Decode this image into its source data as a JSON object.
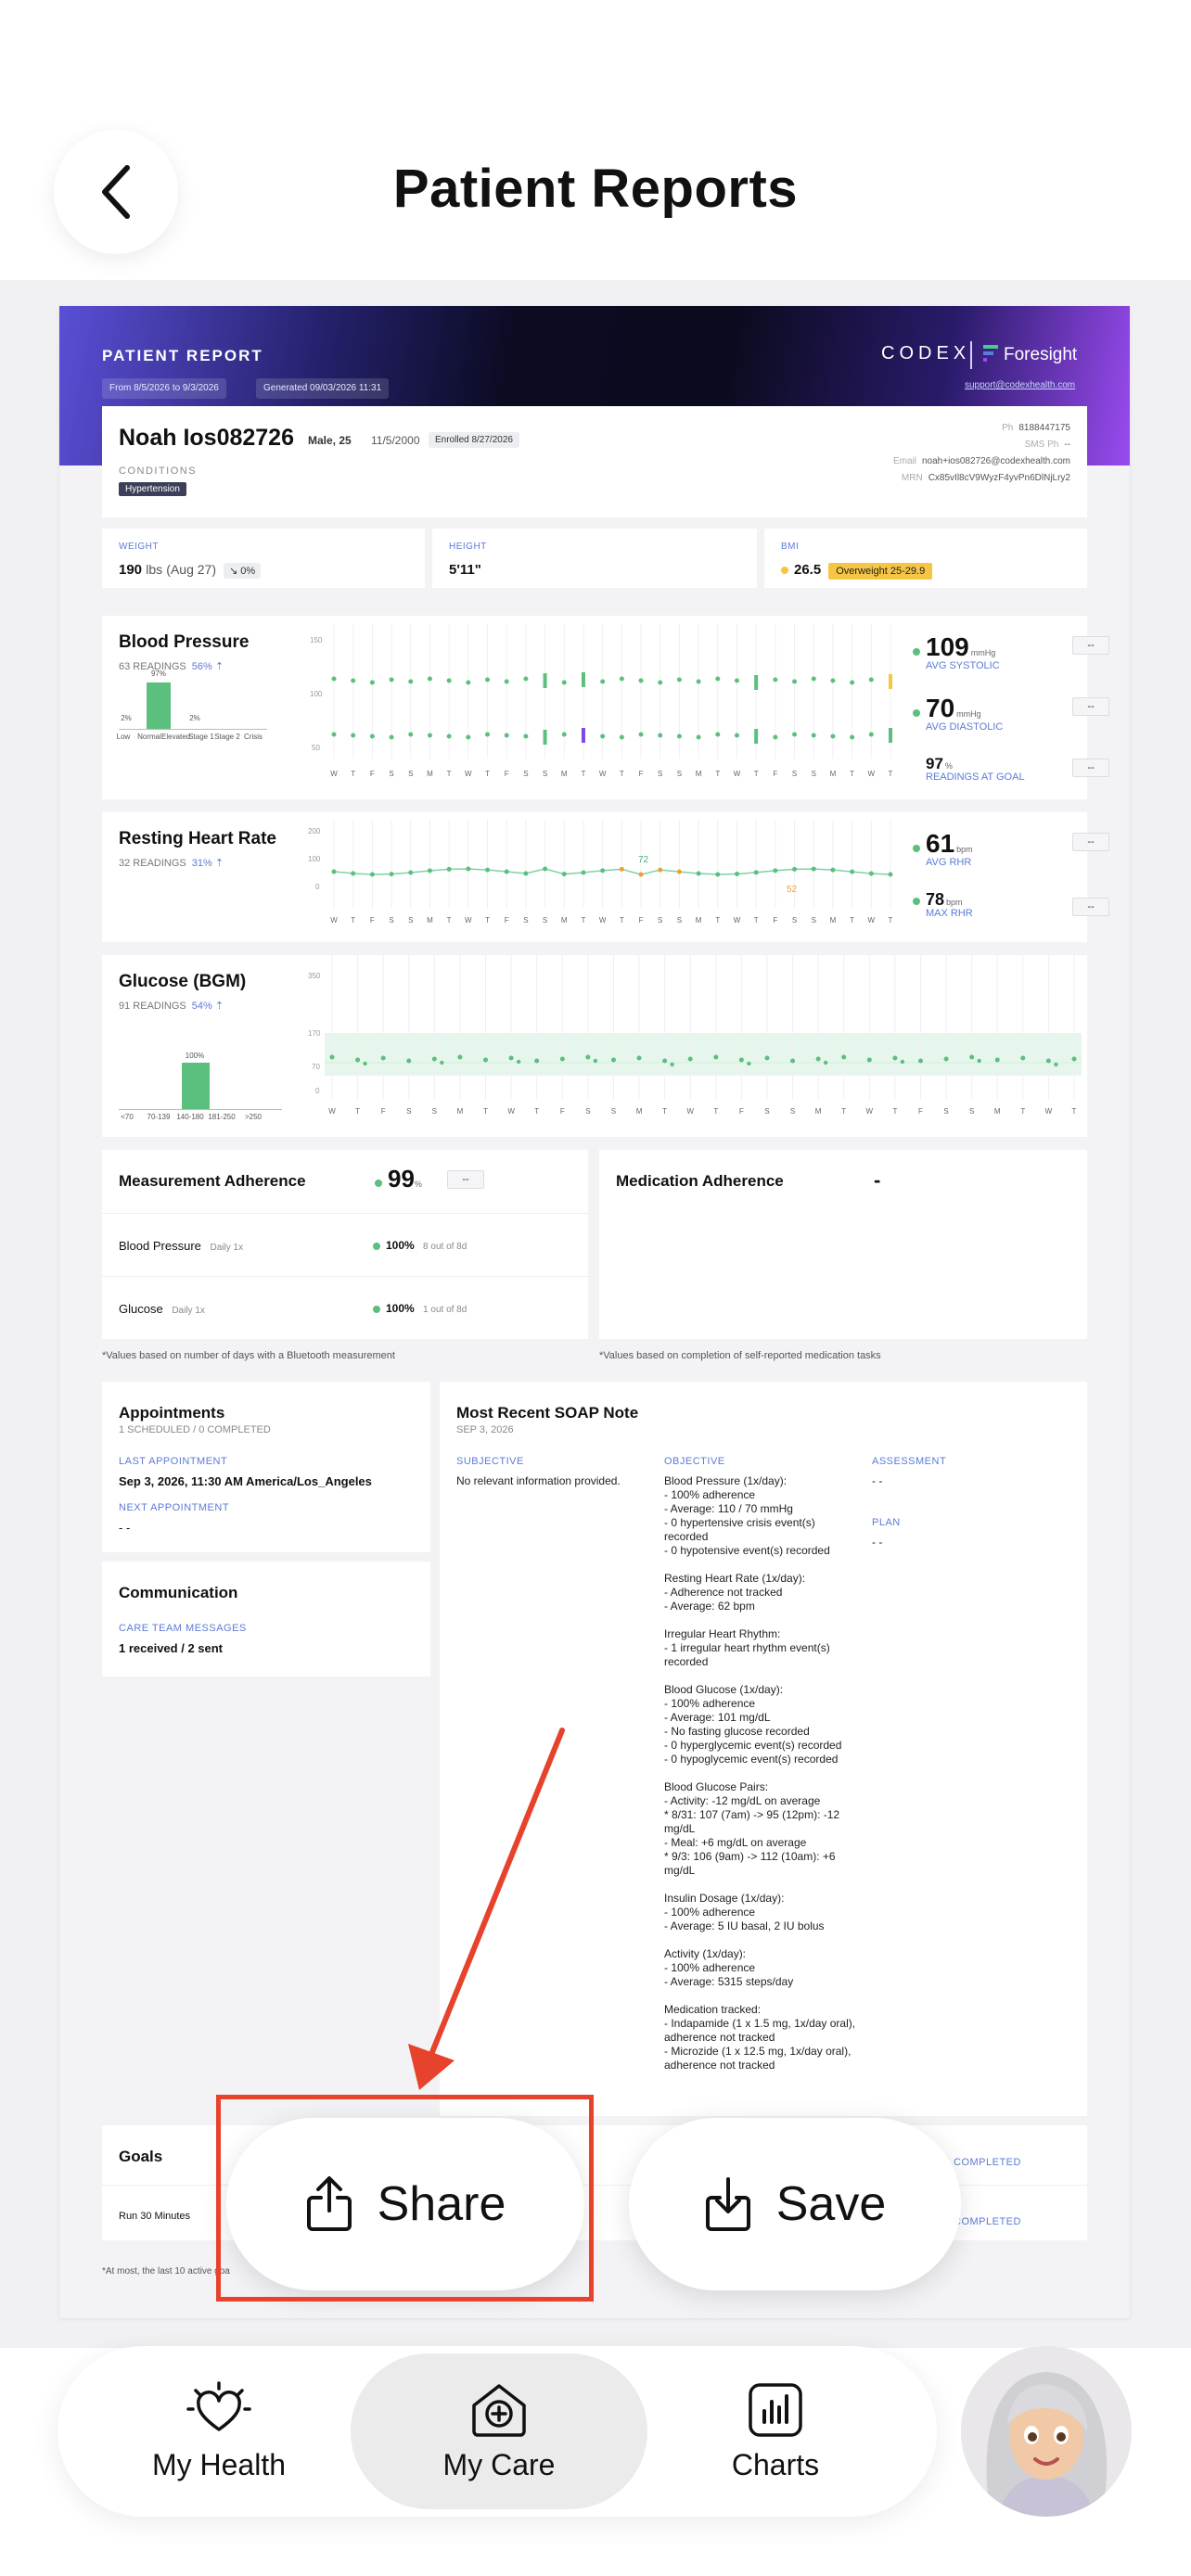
{
  "header": {
    "title": "Patient Reports"
  },
  "report": {
    "title": "PATIENT REPORT",
    "date_range": "From 8/5/2026 to 9/3/2026",
    "generated": "Generated 09/03/2026 11:31",
    "brand": "CODEX",
    "partner": "Foresight",
    "support_email": "support@codexhealth.com",
    "patient": {
      "name": "Noah Ios082726",
      "sex_age": "Male, 25",
      "dob": "11/5/2000",
      "enrolled": "Enrolled 8/27/2026",
      "conditions_label": "CONDITIONS",
      "condition": "Hypertension",
      "ph_label": "Ph",
      "ph": "8188447175",
      "sms_label": "SMS Ph",
      "sms": "--",
      "email_label": "Email",
      "email": "noah+ios082726@codexhealth.com",
      "mrn_label": "MRN",
      "mrn": "Cx85vIl8cV9WyzF4yvPn6DlNjLry2"
    },
    "weight": {
      "label": "WEIGHT",
      "value": "190",
      "unit": "lbs",
      "date": "(Aug 27)",
      "trend": "↘ 0%"
    },
    "height": {
      "label": "HEIGHT",
      "value": "5'11\""
    },
    "bmi": {
      "label": "BMI",
      "value": "26.5",
      "category": "Overweight 25-29.9",
      "color": "#f6c544"
    },
    "bp": {
      "title": "Blood Pressure",
      "readings": "63 READINGS",
      "pct": "56% ⇡",
      "avg_sys": "109",
      "sys_unit": "mmHg",
      "sys_label": "AVG SYSTOLIC",
      "avg_dia": "70",
      "dia_unit": "mmHg",
      "dia_label": "AVG DIASTOLIC",
      "goal": "97",
      "goal_unit": "%",
      "goal_label": "READINGS AT GOAL",
      "dash": "--",
      "y_ticks": [
        "150",
        "100",
        "50"
      ],
      "hist": {
        "pct_low": "2%",
        "pct_normal": "97%",
        "pct_elev": "2%",
        "labels": [
          "Low",
          "Normal",
          "Elevated",
          "Stage 1",
          "Stage 2",
          "Crisis"
        ]
      }
    },
    "rhr": {
      "title": "Resting Heart Rate",
      "readings": "32 READINGS",
      "pct": "31% ⇡",
      "avg": "61",
      "unit": "bpm",
      "avg_label": "AVG RHR",
      "max": "78",
      "max_label": "MAX RHR",
      "dash": "--",
      "y_ticks": [
        "200",
        "100",
        "0"
      ],
      "peak": "72",
      "low": "52"
    },
    "glucose": {
      "title": "Glucose (BGM)",
      "readings": "91 READINGS",
      "pct": "54% ⇡",
      "y_ticks": [
        "350",
        "170",
        "70",
        "0"
      ],
      "hist": {
        "pct": "100%",
        "labels": [
          "<70",
          "70-139",
          "140-180",
          "181-250",
          ">250"
        ]
      }
    },
    "x_days": [
      "W",
      "T",
      "F",
      "S",
      "S",
      "M",
      "T",
      "W",
      "T",
      "F",
      "S",
      "S",
      "M",
      "T",
      "W",
      "T",
      "F",
      "S",
      "S",
      "M",
      "T",
      "W",
      "T",
      "F",
      "S",
      "S",
      "M",
      "T",
      "W",
      "T"
    ],
    "adherence": {
      "title": "Measurement Adherence",
      "value": "99",
      "unit": "%",
      "dash": "--",
      "rows": [
        {
          "name": "Blood Pressure",
          "freq": "Daily 1x",
          "pct": "100%",
          "detail": "8 out of 8d"
        },
        {
          "name": "Glucose",
          "freq": "Daily 1x",
          "pct": "100%",
          "detail": "1 out of 8d"
        }
      ],
      "note": "*Values based on number of days with a Bluetooth measurement"
    },
    "med": {
      "title": "Medication Adherence",
      "value": "-",
      "note": "*Values based on completion of self-reported medication tasks"
    },
    "appointments": {
      "title": "Appointments",
      "sub": "1 SCHEDULED / 0 COMPLETED",
      "last_label": "LAST APPOINTMENT",
      "last": "Sep 3, 2026, 11:30 AM America/Los_Angeles",
      "next_label": "NEXT APPOINTMENT",
      "next": "- -"
    },
    "communication": {
      "title": "Communication",
      "label": "CARE TEAM MESSAGES",
      "value": "1 received / 2 sent"
    },
    "soap": {
      "title": "Most Recent SOAP Note",
      "date": "SEP 3, 2026",
      "subjective_label": "SUBJECTIVE",
      "subjective": "No relevant information provided.",
      "objective_label": "OBJECTIVE",
      "objective": "Blood Pressure (1x/day):\n- 100% adherence\n- Average: 110 / 70 mmHg\n- 0 hypertensive crisis event(s) recorded\n- 0 hypotensive event(s) recorded\n\nResting Heart Rate (1x/day):\n- Adherence not tracked\n- Average: 62 bpm\n\nIrregular Heart Rhythm:\n- 1 irregular heart rhythm event(s) recorded\n\nBlood Glucose (1x/day):\n- 100% adherence\n- Average: 101 mg/dL\n- No fasting glucose recorded\n- 0 hyperglycemic event(s) recorded\n- 0 hypoglycemic event(s) recorded\n\nBlood Glucose Pairs:\n- Activity: -12 mg/dL on average\n   * 8/31: 107 (7am) -> 95 (12pm): -12 mg/dL\n- Meal: +6 mg/dL on average\n   * 9/3: 106 (9am) -> 112 (10am): +6 mg/dL\n\nInsulin Dosage (1x/day):\n- 100% adherence\n- Average: 5 IU basal, 2 IU bolus\n\nActivity (1x/day):\n- 100% adherence\n- Average: 5315 steps/day\n\nMedication tracked:\n- Indapamide (1 x 1.5 mg, 1x/day oral), adherence not tracked\n- Microzide (1 x 12.5 mg, 1x/day oral), adherence not tracked",
      "assessment_label": "ASSESSMENT",
      "assessment": "- -",
      "plan_label": "PLAN",
      "plan": "- -"
    },
    "goals": {
      "title": "Goals",
      "row": "Run 30 Minutes",
      "completed": "COMPLETED",
      "note": "*At most, the last 10 active goa"
    }
  },
  "actions": {
    "share": "Share",
    "save": "Save"
  },
  "tabs": [
    {
      "label": "My Health"
    },
    {
      "label": "My Care"
    },
    {
      "label": "Charts"
    }
  ],
  "colors": {
    "accent": "#5b7bd6",
    "green": "#5bbf7e",
    "highlight": "#e7422b"
  }
}
